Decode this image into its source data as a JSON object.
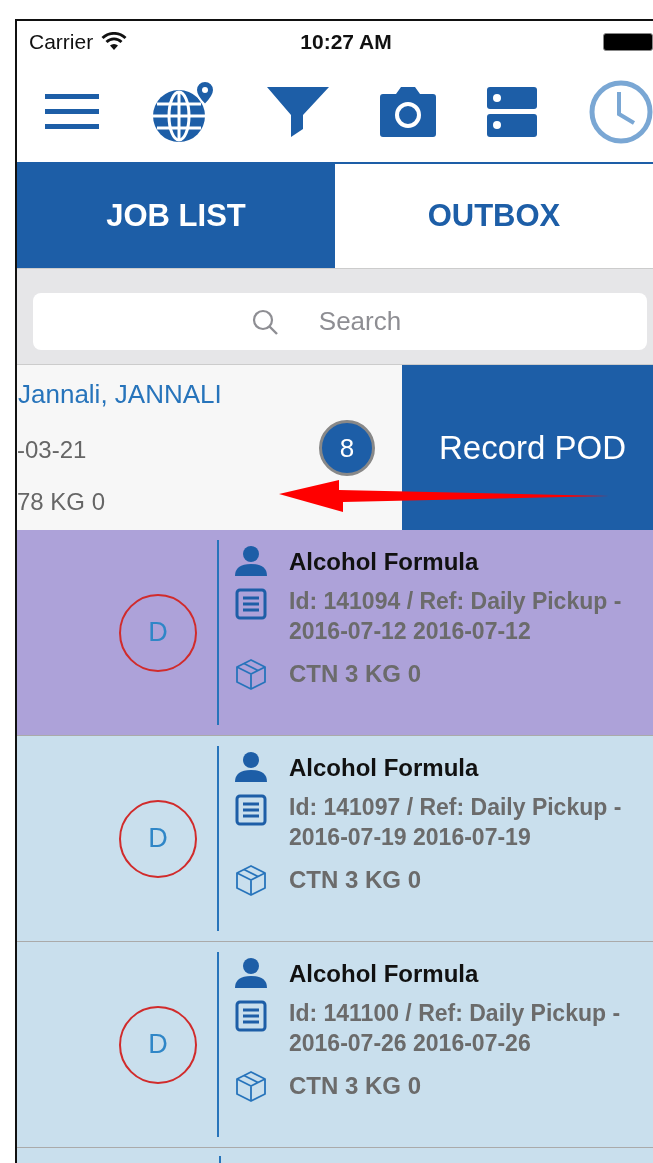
{
  "status_bar": {
    "carrier": "Carrier",
    "time": "10:27 AM"
  },
  "tabs": [
    {
      "label": "JOB LIST",
      "selected": true
    },
    {
      "label": "OUTBOX",
      "selected": false
    }
  ],
  "search": {
    "placeholder": "Search"
  },
  "swiped_row": {
    "title": "Jannali, JANNALI",
    "line_2": "-03-21",
    "line_3": "78 KG 0",
    "badge": "8",
    "action": "Record POD"
  },
  "jobs": [
    {
      "status": "D",
      "name": "Alcohol Formula",
      "reference": "Id: 141094 / Ref: Daily Pickup - 2016-07-12 2016-07-12",
      "quantity": "CTN 3 KG 0",
      "color": "#ada2d9"
    },
    {
      "status": "D",
      "name": "Alcohol Formula",
      "reference": "Id: 141097 / Ref: Daily Pickup - 2016-07-19 2016-07-19",
      "quantity": "CTN 3 KG 0",
      "color": "#c9dfed"
    },
    {
      "status": "D",
      "name": "Alcohol Formula",
      "reference": "Id: 141100 / Ref: Daily Pickup - 2016-07-26 2016-07-26",
      "quantity": "CTN 3 KG 0",
      "color": "#c9dfed"
    }
  ]
}
